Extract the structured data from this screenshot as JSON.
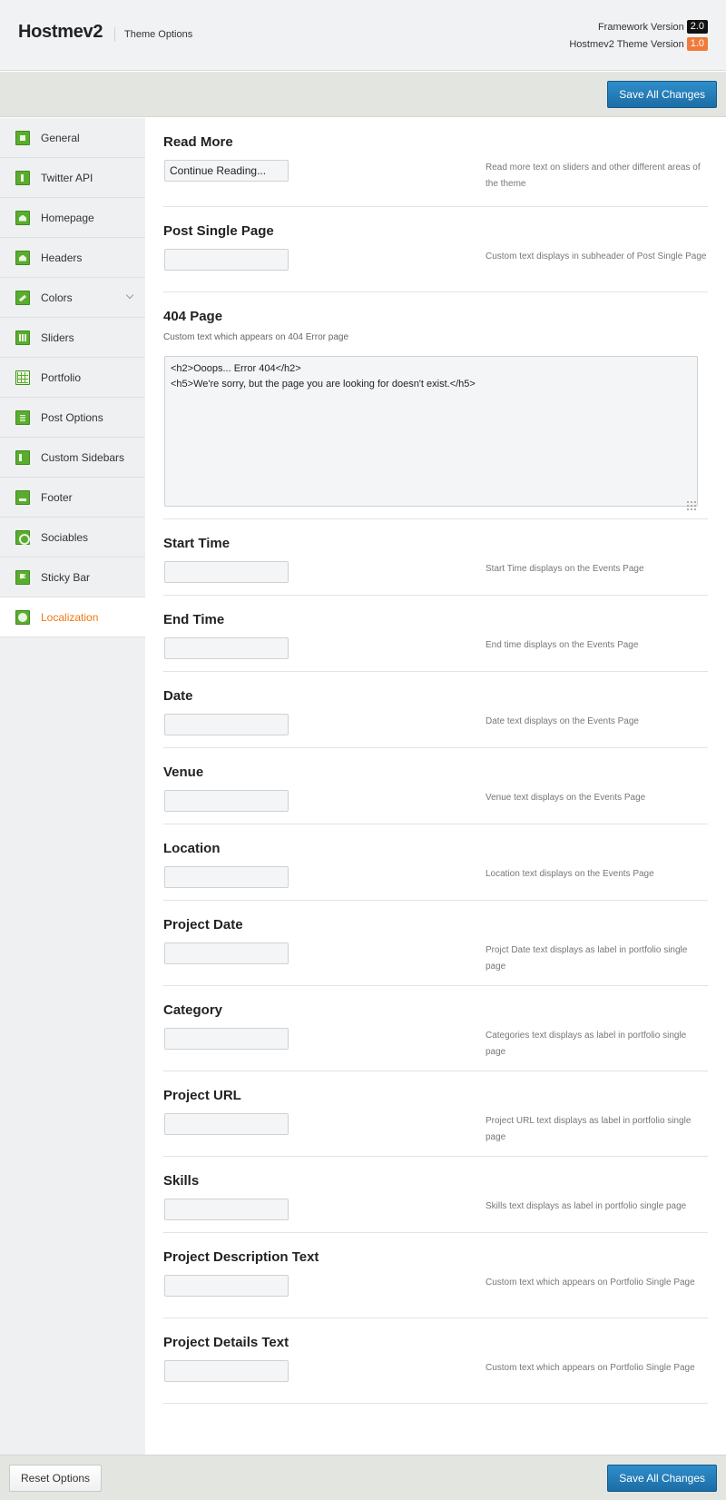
{
  "header": {
    "brand": "Hostmev2",
    "subtitle": "Theme Options",
    "framework_label": "Framework Version",
    "framework_version": "2.0",
    "theme_label": "Hostmev2 Theme Version",
    "theme_version": "1.0"
  },
  "toolbar": {
    "save_label": "Save All Changes"
  },
  "sidebar": {
    "items": [
      {
        "label": "General",
        "icon": "gear-icon"
      },
      {
        "label": "Twitter API",
        "icon": "twitter-icon"
      },
      {
        "label": "Homepage",
        "icon": "home-icon"
      },
      {
        "label": "Headers",
        "icon": "home-icon"
      },
      {
        "label": "Colors",
        "icon": "brush-icon"
      },
      {
        "label": "Sliders",
        "icon": "slider-icon"
      },
      {
        "label": "Portfolio",
        "icon": "grid-icon"
      },
      {
        "label": "Post Options",
        "icon": "post-icon"
      },
      {
        "label": "Custom Sidebars",
        "icon": "sidebar-icon"
      },
      {
        "label": "Footer",
        "icon": "footer-icon"
      },
      {
        "label": "Sociables",
        "icon": "link-icon"
      },
      {
        "label": "Sticky Bar",
        "icon": "flag-icon"
      },
      {
        "label": "Localization",
        "icon": "globe-icon"
      }
    ],
    "active_item": "Localization",
    "active_color": "#f07a10"
  },
  "sections": {
    "read_more": {
      "title": "Read More",
      "value": "Continue Reading...",
      "desc": "Read more text on sliders and other different areas of the theme"
    },
    "post_single": {
      "title": "Post Single Page",
      "value": "",
      "desc": "Custom text displays in subheader of Post Single Page"
    },
    "page_404": {
      "title": "404 Page",
      "subtitle": "Custom text which appears on 404 Error page",
      "value": "<h2>Ooops... Error 404</h2>\n<h5>We're sorry, but the page you are looking for doesn't exist.</h5>"
    },
    "start_time": {
      "title": "Start Time",
      "value": "",
      "desc": "Start Time displays on the Events Page"
    },
    "end_time": {
      "title": "End Time",
      "value": "",
      "desc": "End time displays on the Events Page"
    },
    "date": {
      "title": "Date",
      "value": "",
      "desc": "Date text displays on the Events Page"
    },
    "venue": {
      "title": "Venue",
      "value": "",
      "desc": "Venue text displays on the Events Page"
    },
    "location": {
      "title": "Location",
      "value": "",
      "desc": "Location text displays on the Events Page"
    },
    "project_date": {
      "title": "Project Date",
      "value": "",
      "desc": "Projct Date text displays as label in portfolio single page"
    },
    "category": {
      "title": "Category",
      "value": "",
      "desc": "Categories text displays as label in portfolio single page"
    },
    "project_url": {
      "title": "Project URL",
      "value": "",
      "desc": "Project URL text displays as label in portfolio single page"
    },
    "skills": {
      "title": "Skills",
      "value": "",
      "desc": "Skills text displays as label in portfolio single page"
    },
    "project_desc": {
      "title": "Project Description Text",
      "value": "",
      "desc": "Custom text which appears on Portfolio Single Page"
    },
    "project_details": {
      "title": "Project Details Text",
      "value": "",
      "desc": "Custom text which appears on Portfolio Single Page"
    }
  },
  "footer": {
    "reset_label": "Reset Options",
    "save_label": "Save All Changes"
  },
  "colors": {
    "primary_button": "#1f76b3",
    "accent_green": "#5aac2f",
    "version_badge_orange": "#f07a3a"
  }
}
